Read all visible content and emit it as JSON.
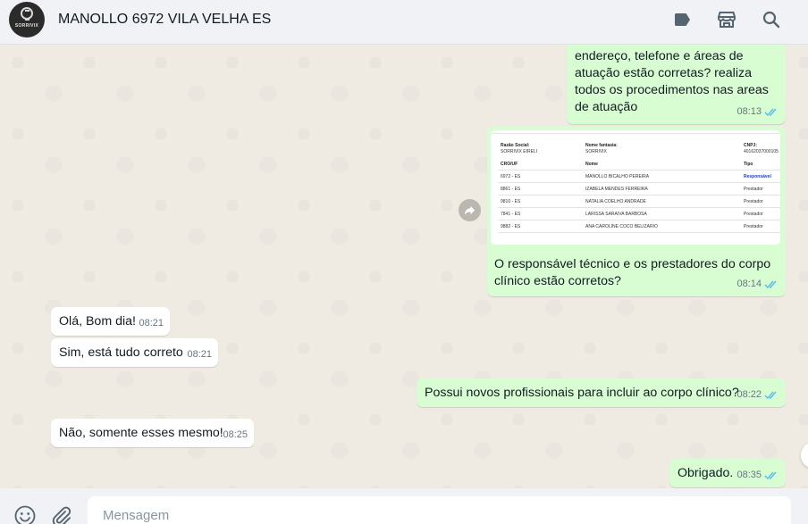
{
  "header": {
    "contact_name": "MANOLLO 6972 VILA VELHA ES",
    "avatar_brand": "SORRIVIX",
    "icons": [
      "label-icon",
      "store-icon",
      "search-icon"
    ]
  },
  "messages": [
    {
      "direction": "outgoing",
      "text": "endereço, telefone e áreas de atuação estão corretas? realiza todos os procedimentos nas areas de atuação",
      "time": "08:13",
      "status": "read"
    },
    {
      "direction": "outgoing",
      "type": "image_with_caption",
      "text": "O responsável técnico e os prestadores do corpo clínico estão corretos?",
      "time": "08:14",
      "status": "read",
      "image": {
        "razao_label": "Razão Social:",
        "razao_value": "SORRIVIX EIRELI",
        "fantasia_label": "Nome fantasia:",
        "fantasia_value": "SORRIVIX",
        "cnpj_label": "CNPJ:",
        "cnpj_value": "40162037000105",
        "columns": [
          "CRO/UF",
          "Nome",
          "Tipo"
        ],
        "rows": [
          [
            "6972 - ES",
            "MANOLLO BICALHO PEREIRA",
            "Responsável"
          ],
          [
            "8861 - ES",
            "IZABELA MENDES FERREIRA",
            "Prestador"
          ],
          [
            "9810 - ES",
            "NATALIA COELHO ANDRADE",
            "Prestador"
          ],
          [
            "7841 - ES",
            "LARISSA SARAIVA BARBOSA",
            "Prestador"
          ],
          [
            "9882 - ES",
            "ANA CAROLINE COCO BELIZARIO",
            "Prestador"
          ]
        ]
      }
    },
    {
      "direction": "incoming",
      "text": "Olá, Bom dia!",
      "time": "08:21"
    },
    {
      "direction": "incoming",
      "text": "Sim, está tudo correto",
      "time": "08:21"
    },
    {
      "direction": "outgoing",
      "text": "Possui novos profissionais para incluir ao corpo clínico?",
      "time": "08:22",
      "status": "read"
    },
    {
      "direction": "incoming",
      "text": "Não, somente esses mesmo!",
      "time": "08:25"
    },
    {
      "direction": "outgoing",
      "text": "Obrigado.",
      "time": "08:35",
      "status": "read"
    }
  ],
  "composer": {
    "placeholder": "Mensagem",
    "icons": [
      "emoji-icon",
      "attach-icon"
    ]
  },
  "colors": {
    "outgoing_bubble": "#d9fdd3",
    "incoming_bubble": "#ffffff",
    "chat_background": "#efeae2",
    "read_tick": "#53bdeb"
  }
}
